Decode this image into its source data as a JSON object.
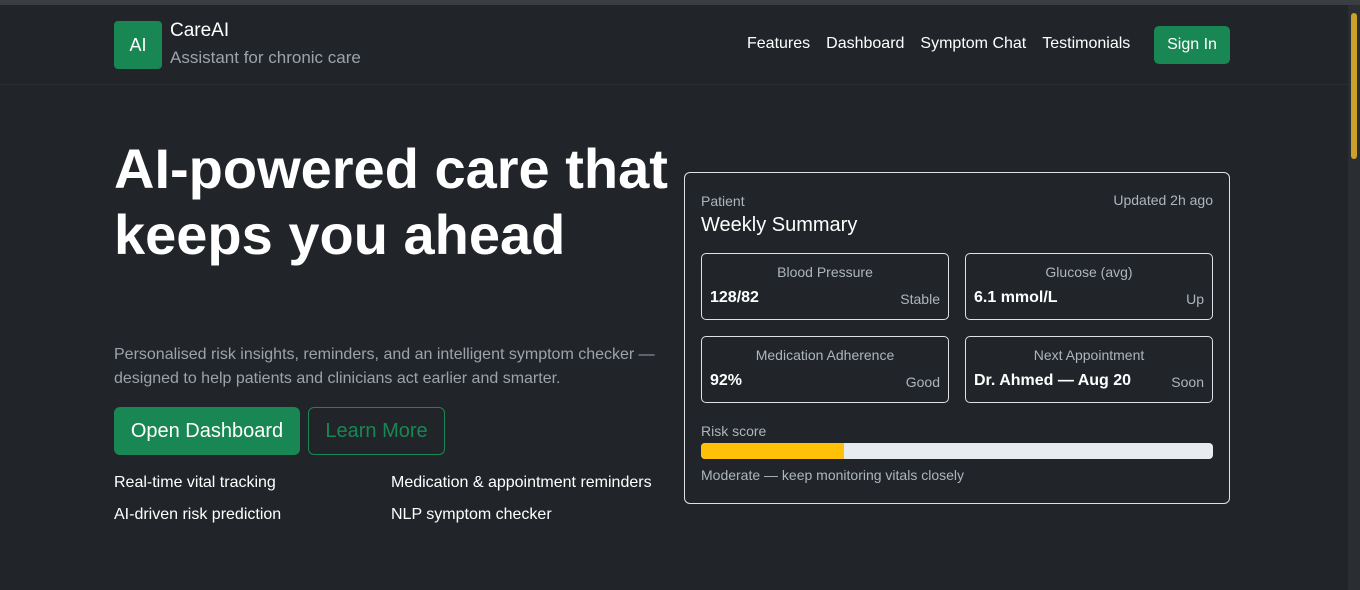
{
  "brand": {
    "logo_text": "AI",
    "name": "CareAI",
    "tagline": "Assistant for chronic care"
  },
  "nav": {
    "links": [
      "Features",
      "Dashboard",
      "Symptom Chat",
      "Testimonials"
    ],
    "signin_label": "Sign In"
  },
  "hero": {
    "title": "AI-powered care that keeps you ahead",
    "subtitle": "Personalised risk insights, reminders, and an intelligent symptom checker — designed to help patients and clinicians act earlier and smarter.",
    "primary_button": "Open Dashboard",
    "secondary_button": "Learn More",
    "features": [
      "Real-time vital tracking",
      "Medication & appointment reminders",
      "AI-driven risk prediction",
      "NLP symptom checker"
    ]
  },
  "summary": {
    "label": "Patient",
    "title": "Weekly Summary",
    "updated": "Updated 2h ago",
    "stats": [
      {
        "label": "Blood Pressure",
        "value": "128/82",
        "status": "Stable"
      },
      {
        "label": "Glucose (avg)",
        "value": "6.1 mmol/L",
        "status": "Up"
      },
      {
        "label": "Medication Adherence",
        "value": "92%",
        "status": "Good"
      },
      {
        "label": "Next Appointment",
        "value": "Dr. Ahmed — Aug 20",
        "status": "Soon"
      }
    ],
    "risk_label": "Risk score",
    "risk_fraction": 0.28,
    "risk_note": "Moderate — keep monitoring vitals closely"
  },
  "colors": {
    "background": "#212529",
    "brand": "#198754",
    "risk": "#ffc107",
    "muted": "#adb5bd"
  }
}
